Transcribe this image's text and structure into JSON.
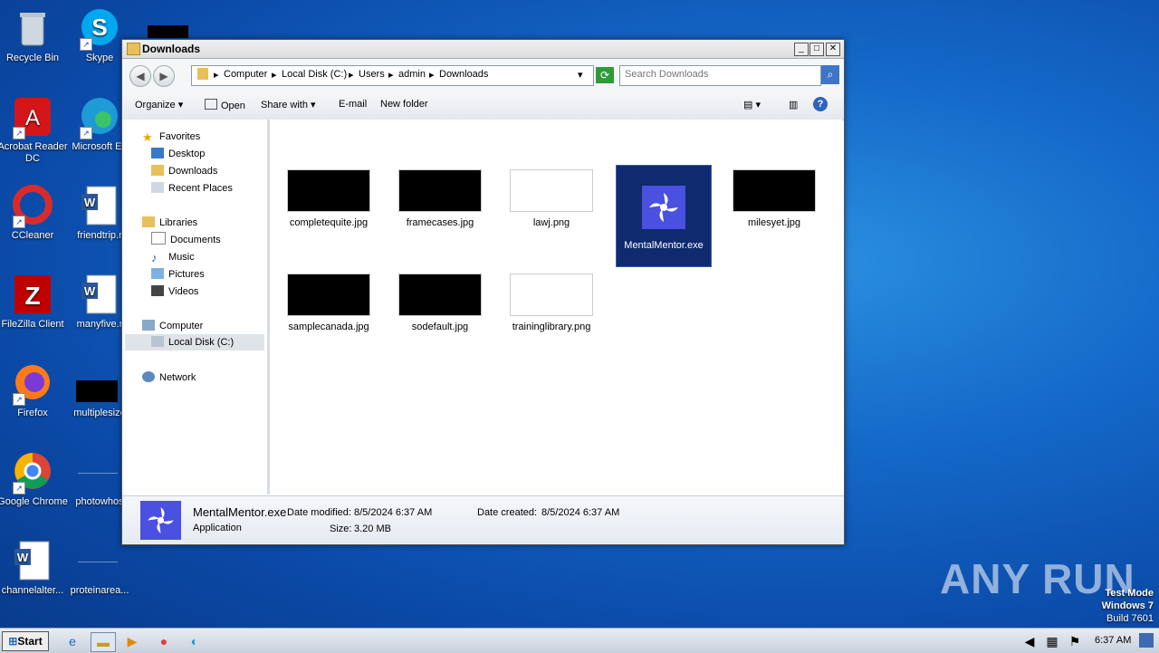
{
  "desktop": {
    "icons": [
      {
        "label": "Recycle Bin"
      },
      {
        "label": "Skype"
      },
      {
        "label": "Acrobat Reader DC"
      },
      {
        "label": "Microsoft Ed"
      },
      {
        "label": "CCleaner"
      },
      {
        "label": "friendtrip.r"
      },
      {
        "label": "FileZilla Client"
      },
      {
        "label": "manyfive.r"
      },
      {
        "label": "Firefox"
      },
      {
        "label": "multiplesize"
      },
      {
        "label": "Google Chrome"
      },
      {
        "label": "photowhos"
      },
      {
        "label": "channelalter..."
      },
      {
        "label": "proteinarea..."
      }
    ]
  },
  "window": {
    "title": "Downloads",
    "breadcrumb": [
      "Computer",
      "Local Disk (C:)",
      "Users",
      "admin",
      "Downloads"
    ],
    "search_placeholder": "Search Downloads",
    "toolbar": {
      "organize": "Organize",
      "open": "Open",
      "share": "Share with",
      "email": "E-mail",
      "new_folder": "New folder"
    },
    "nav": {
      "favorites": "Favorites",
      "desktop": "Desktop",
      "downloads": "Downloads",
      "recent": "Recent Places",
      "libraries": "Libraries",
      "documents": "Documents",
      "music": "Music",
      "pictures": "Pictures",
      "videos": "Videos",
      "computer": "Computer",
      "local_disk": "Local Disk (C:)",
      "network": "Network"
    },
    "files": [
      {
        "name": "completequite.jpg"
      },
      {
        "name": "framecases.jpg"
      },
      {
        "name": "lawj.png"
      },
      {
        "name": "MentalMentor.exe"
      },
      {
        "name": "milesyet.jpg"
      },
      {
        "name": "samplecanada.jpg"
      },
      {
        "name": "sodefault.jpg"
      },
      {
        "name": "traininglibrary.png"
      }
    ],
    "details": {
      "name": "MentalMentor.exe",
      "type": "Application",
      "modified_label": "Date modified:",
      "modified": "8/5/2024 6:37 AM",
      "size_label": "Size:",
      "size": "3.20 MB",
      "created_label": "Date created:",
      "created": "8/5/2024 6:37 AM"
    }
  },
  "taskbar": {
    "start": "Start",
    "clock": "6:37 AM"
  },
  "watermark": "ANY RUN",
  "testmode": {
    "line1": "Test Mode",
    "line2": "Windows 7",
    "line3": "Build 7601"
  }
}
